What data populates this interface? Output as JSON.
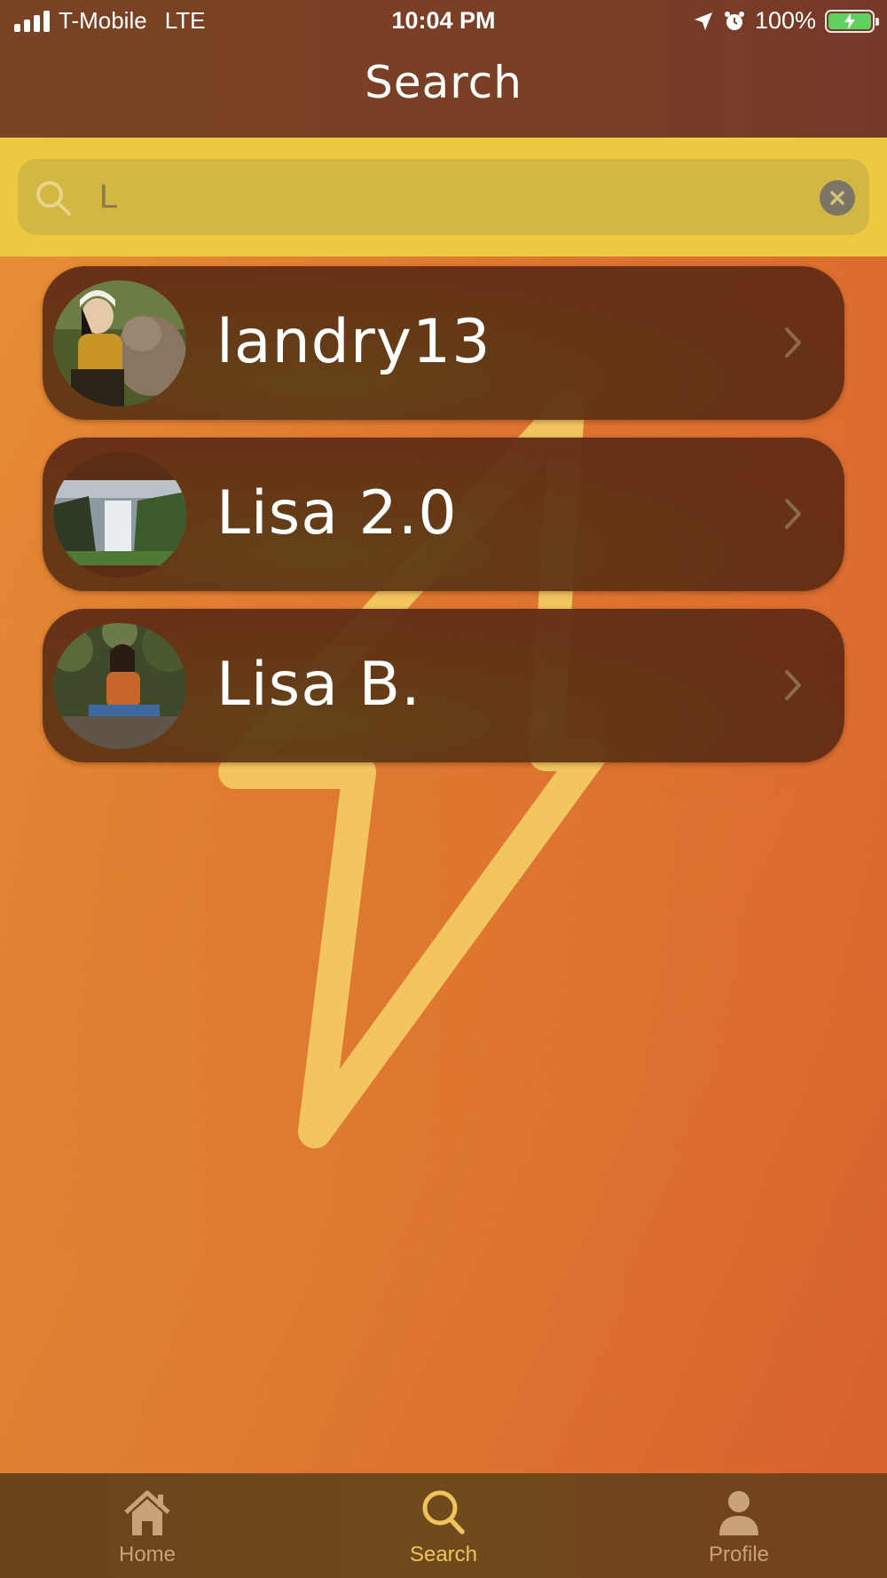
{
  "status_bar": {
    "carrier": "T-Mobile",
    "network": "LTE",
    "time": "10:04 PM",
    "battery": "100%"
  },
  "header": {
    "title": "Search"
  },
  "search": {
    "value": "L",
    "placeholder": ""
  },
  "results": [
    {
      "name": "landry13",
      "avatar": "avatar-person-with-dog"
    },
    {
      "name": "Lisa 2.0",
      "avatar": "avatar-waterfall"
    },
    {
      "name": "Lisa B.",
      "avatar": "avatar-person-sitting"
    }
  ],
  "tabs": [
    {
      "label": "Home",
      "icon": "home-icon",
      "active": false
    },
    {
      "label": "Search",
      "icon": "search-icon",
      "active": true
    },
    {
      "label": "Profile",
      "icon": "person-icon",
      "active": false
    }
  ],
  "colors": {
    "header": "#7a4325",
    "search_band": "#ecc941",
    "result_card": "#622c14",
    "bolt": "#f2c55f",
    "tab_active": "#f0c45a",
    "tab_inactive": "#c9a27a"
  }
}
